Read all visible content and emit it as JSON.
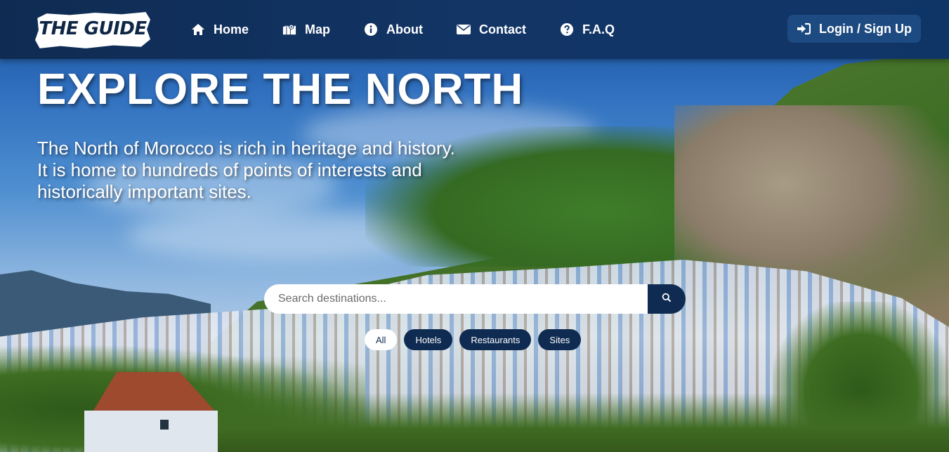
{
  "brand": {
    "logo_text": "THE GUIDE"
  },
  "nav": {
    "items": [
      {
        "label": "Home",
        "icon": "home-icon"
      },
      {
        "label": "Map",
        "icon": "map-icon"
      },
      {
        "label": "About",
        "icon": "info-icon"
      },
      {
        "label": "Contact",
        "icon": "envelope-icon"
      },
      {
        "label": "F.A.Q",
        "icon": "question-icon"
      }
    ],
    "login_label": "Login / Sign Up"
  },
  "hero": {
    "title": "EXPLORE THE NORTH",
    "description": [
      "The North of Morocco is rich in heritage and history.",
      "It is home to hundreds of points of interests and historically important sites."
    ]
  },
  "search": {
    "placeholder": "Search destinations...",
    "value": "",
    "button_icon": "search-icon"
  },
  "filters": {
    "options": [
      "All",
      "Hotels",
      "Restaurants",
      "Sites"
    ],
    "selected": "All"
  },
  "colors": {
    "navbar": "#0f2b52",
    "accent": "#1d4a80",
    "text_light": "#ffffff"
  }
}
